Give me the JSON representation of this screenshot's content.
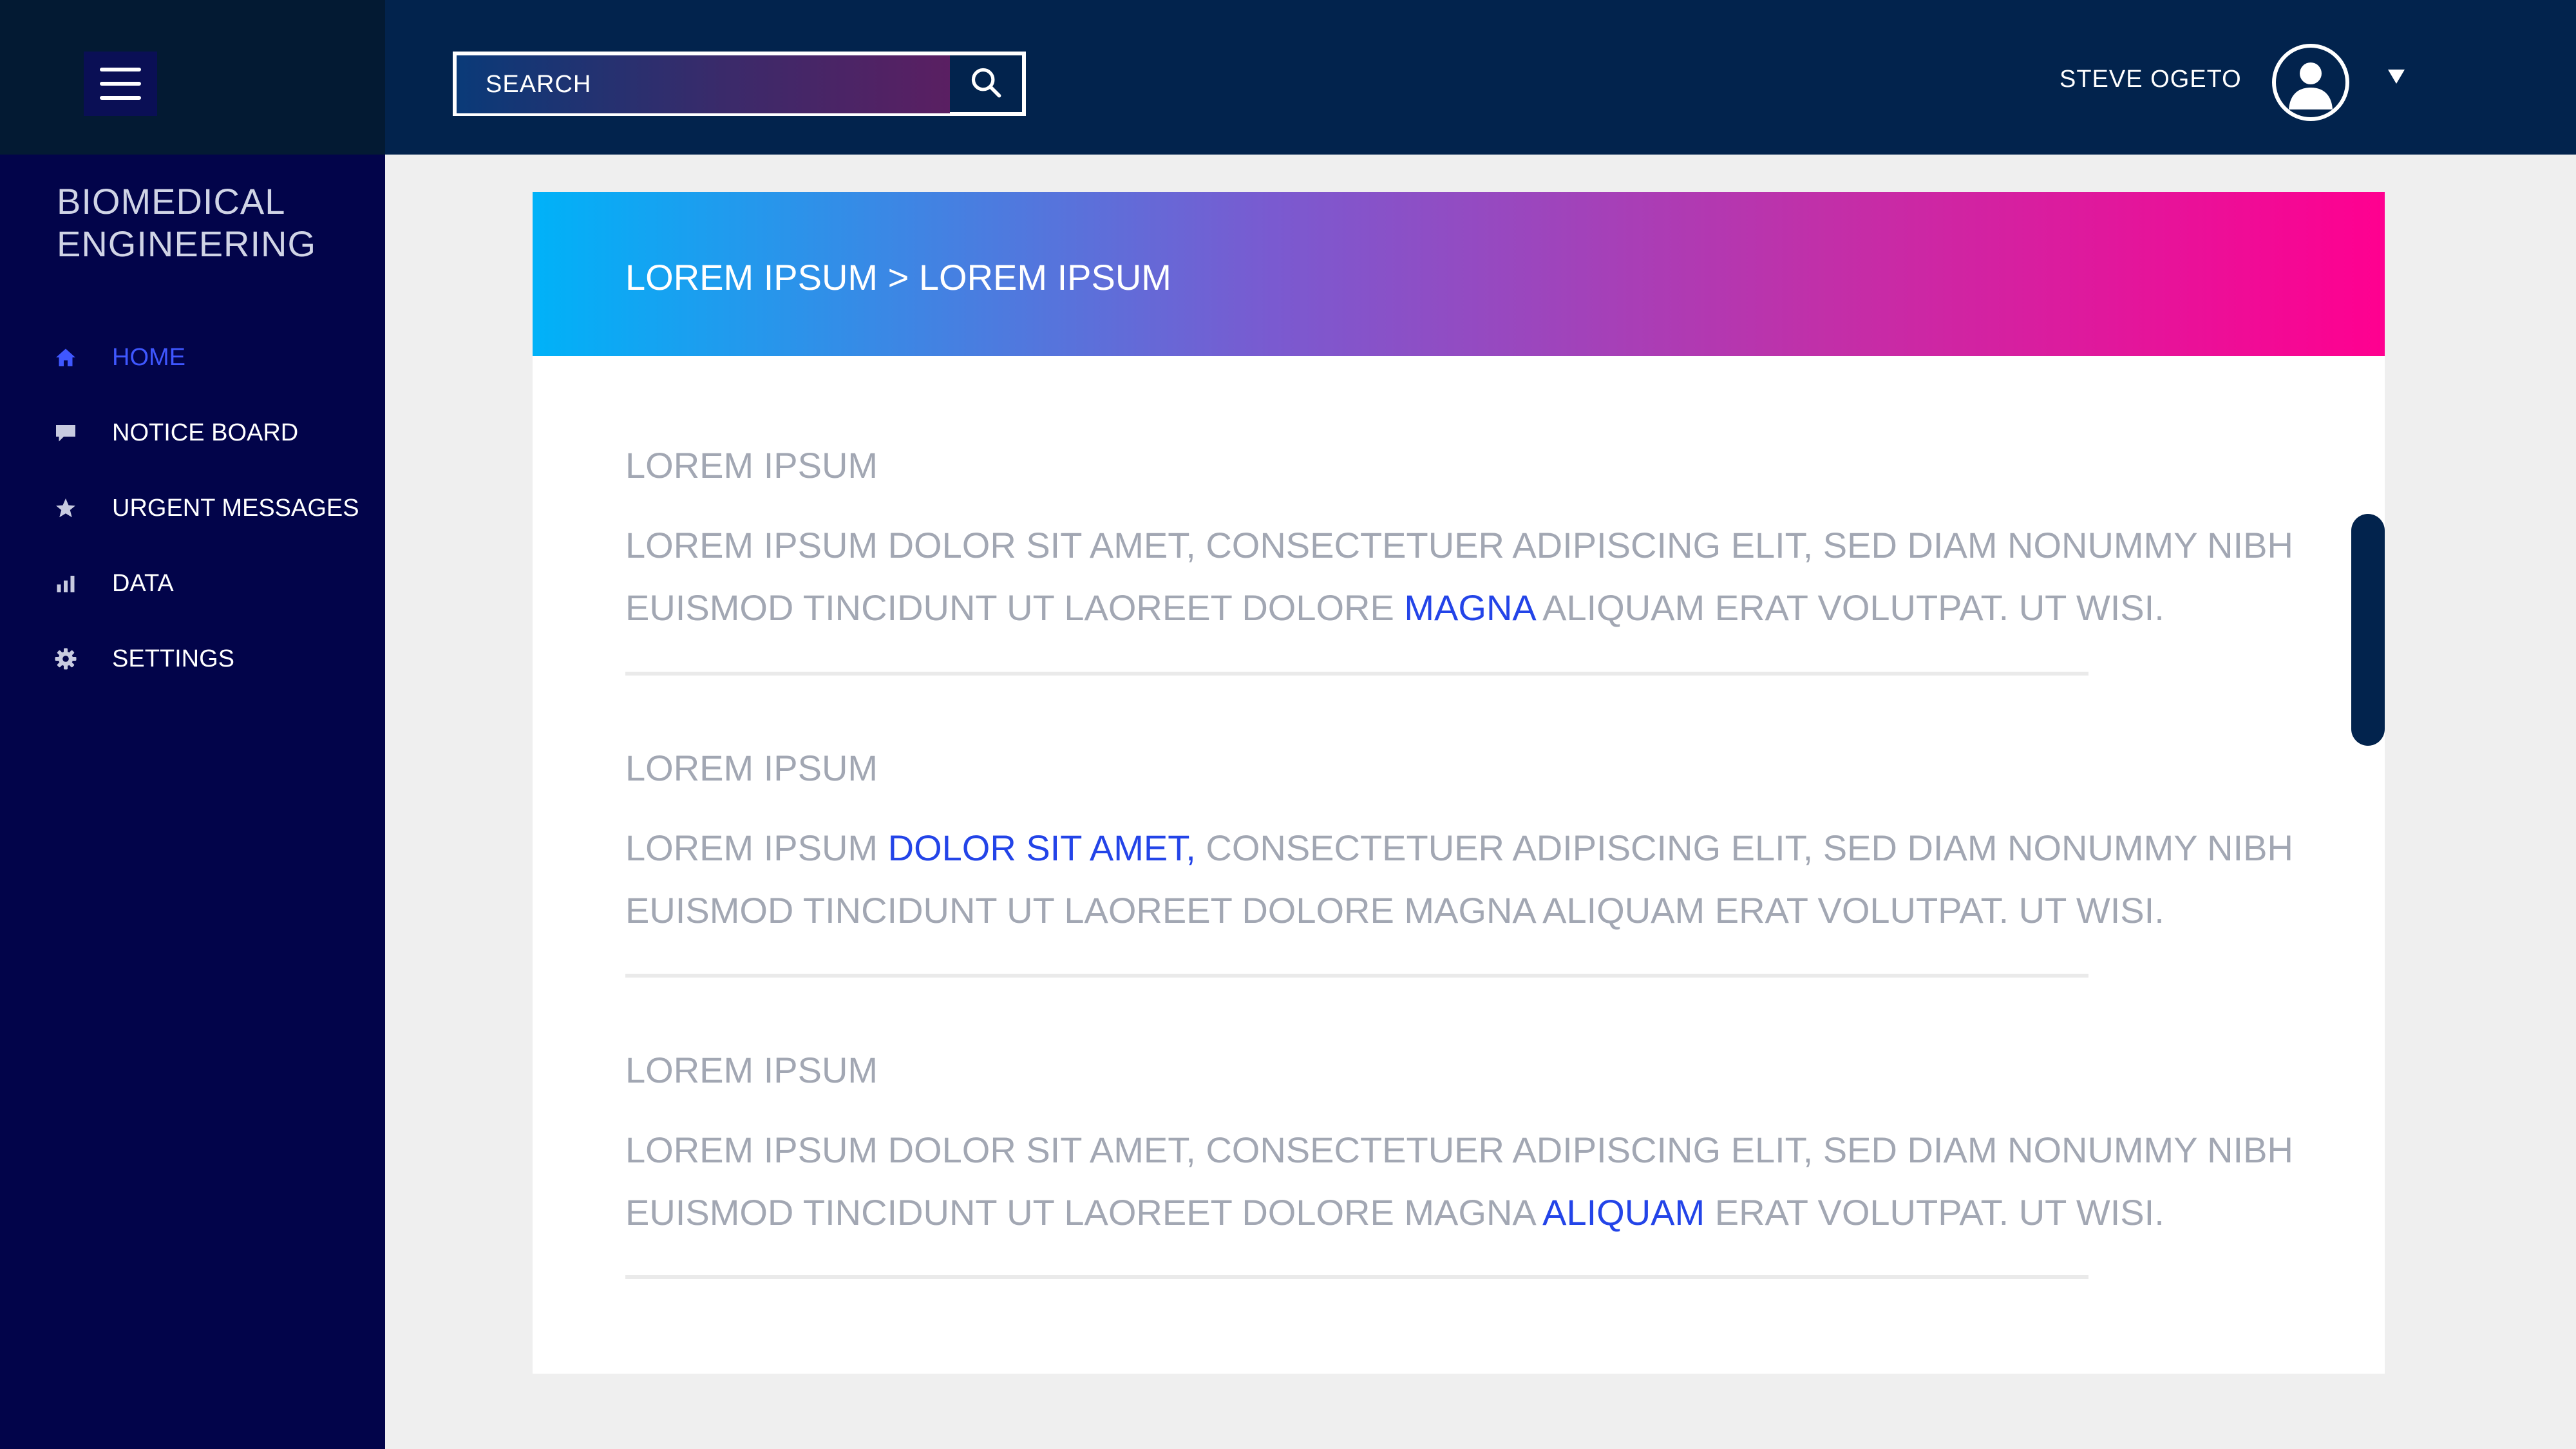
{
  "sidebar": {
    "brand": "BIOMEDICAL ENGINEERING",
    "items": [
      {
        "label": "HOME",
        "icon": "home-icon",
        "active": true
      },
      {
        "label": "NOTICE BOARD",
        "icon": "comment-icon",
        "active": false
      },
      {
        "label": "URGENT MESSAGES",
        "icon": "star-icon",
        "active": false
      },
      {
        "label": "DATA",
        "icon": "bar-chart-icon",
        "active": false
      },
      {
        "label": "SETTINGS",
        "icon": "gear-icon",
        "active": false
      }
    ]
  },
  "header": {
    "search_placeholder": "SEARCH",
    "user_name": "STEVE OGETO"
  },
  "main": {
    "breadcrumb": "LOREM IPSUM > LOREM IPSUM",
    "entries": [
      {
        "title": "LOREM IPSUM",
        "line1": {
          "pre": "LOREM IPSUM DOLOR SIT AMET, CONSECTETUER ADIPISCING ELIT, SED DIAM NONUMMY NIBH",
          "link": "",
          "post": ""
        },
        "line2": {
          "pre": "EUISMOD TINCIDUNT UT LAOREET DOLORE ",
          "link": "MAGNA",
          "post": " ALIQUAM ERAT VOLUTPAT. UT WISI."
        }
      },
      {
        "title": "LOREM IPSUM",
        "line1": {
          "pre": "LOREM IPSUM ",
          "link": "DOLOR SIT AMET,",
          "post": " CONSECTETUER ADIPISCING ELIT, SED DIAM NONUMMY NIBH"
        },
        "line2": {
          "pre": "EUISMOD TINCIDUNT UT LAOREET DOLORE MAGNA  ALIQUAM ERAT VOLUTPAT. UT WISI.",
          "link": "",
          "post": ""
        }
      },
      {
        "title": "LOREM IPSUM",
        "line1": {
          "pre": "LOREM IPSUM DOLOR SIT AMET, CONSECTETUER ADIPISCING ELIT, SED DIAM NONUMMY NIBH",
          "link": "",
          "post": ""
        },
        "line2": {
          "pre": "EUISMOD TINCIDUNT UT LAOREET DOLORE MAGNA ",
          "link": "ALIQUAM",
          "post": " ERAT VOLUTPAT. UT WISI."
        }
      }
    ]
  },
  "colors": {
    "sidebar_bg": "#02044a",
    "header_bg": "#02234d",
    "accent": "#2344e8",
    "active_nav": "#3f57ff",
    "banner_start": "#00b2f8",
    "banner_end": "#ff0090"
  }
}
